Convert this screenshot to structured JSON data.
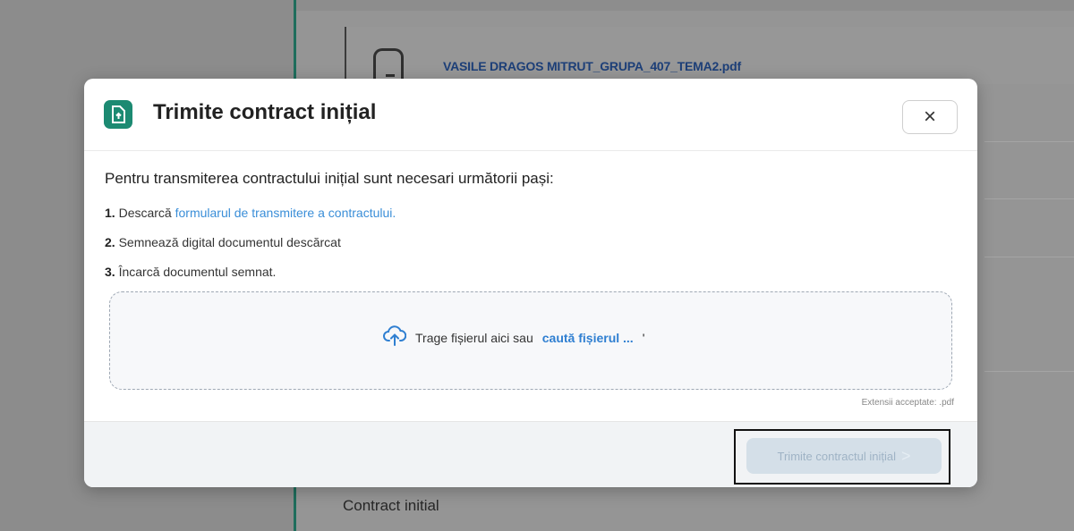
{
  "background": {
    "file_name": "VASILE DRAGOS MITRUT_GRUPA_407_TEMA2.pdf",
    "section_label": "Contract initial"
  },
  "modal": {
    "title": "Trimite contract inițial",
    "close_label": "×",
    "intro": "Pentru transmiterea contractului inițial sunt necesari următorii pași:",
    "steps": [
      {
        "num": "1.",
        "text": "Descarcă ",
        "link": "formularul de transmitere a contractului."
      },
      {
        "num": "2.",
        "text": "Semnează digital documentul descărcat"
      },
      {
        "num": "3.",
        "text": "Încarcă documentul semnat."
      }
    ],
    "dropzone": {
      "text": "Trage fișierul aici sau",
      "browse": "caută fișierul ...",
      "marker": "'"
    },
    "accepted_extensions": "Extensii acceptate: .pdf",
    "submit_label": "Trimite contractul inițial",
    "submit_arrow": ">"
  },
  "colors": {
    "brand": "#1c8a72",
    "link": "#3a8ed8",
    "disabled_button": "#d4dfe8"
  }
}
